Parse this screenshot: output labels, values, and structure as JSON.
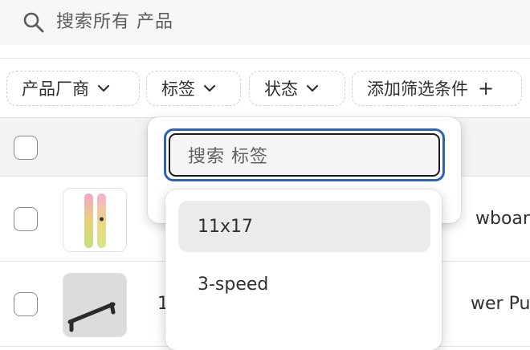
{
  "search": {
    "placeholder": "搜索所有 产品"
  },
  "filters": [
    {
      "label": "产品厂商"
    },
    {
      "label": "标签"
    },
    {
      "label": "状态"
    },
    {
      "label": "添加筛选条件"
    }
  ],
  "tag_popover": {
    "search_placeholder": "搜索 标签",
    "options": [
      "11x17",
      "3-speed"
    ]
  },
  "rows": [
    {
      "title_partial": "wboard"
    },
    {
      "index_partial": "1",
      "title_partial": "wer Pull"
    }
  ]
}
